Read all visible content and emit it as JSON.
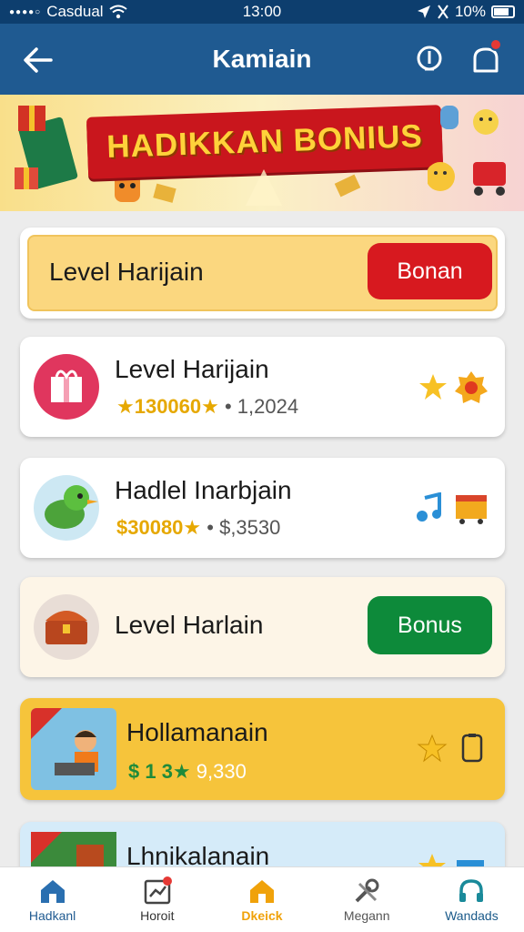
{
  "status_bar": {
    "carrier": "Casdual",
    "time": "13:00",
    "battery": "10%"
  },
  "header": {
    "title": "Kamiain"
  },
  "banner": {
    "title": "HADIKKAN BONIUS"
  },
  "cards": [
    {
      "title": "Level Harijain",
      "button": "Bonan"
    },
    {
      "title": "Level Harijain",
      "stat_gold": "★130060★",
      "stat_gray": "• 1,2024"
    },
    {
      "title": "Hadlel Inarbjain",
      "stat_gold": "$30080★",
      "stat_gray": "• $,3530"
    },
    {
      "title": "Level Harlain",
      "button": "Bonus"
    },
    {
      "title": "Hollamanain",
      "stat_gold": "$ 1 3★",
      "stat_gray": "9,330"
    },
    {
      "title": "Lhnikalanain"
    }
  ],
  "nav": [
    {
      "label": "Hadkanl"
    },
    {
      "label": "Horoit"
    },
    {
      "label": "Dkeick"
    },
    {
      "label": "Megann"
    },
    {
      "label": "Wandads"
    }
  ],
  "colors": {
    "header": "#1f5a91",
    "status": "#0d3e6e",
    "red_button": "#d7191f",
    "green_button": "#0d8a3a",
    "gold_card": "#f6c43b",
    "active_nav": "#f0a20a"
  }
}
